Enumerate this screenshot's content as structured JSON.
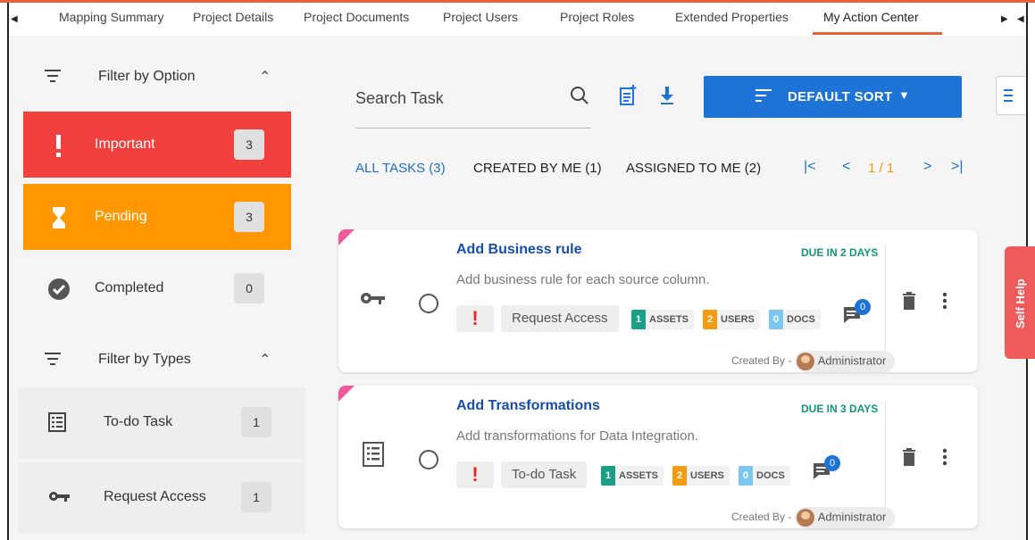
{
  "tabs": [
    {
      "label": "Mapping Summary"
    },
    {
      "label": "Project Details"
    },
    {
      "label": "Project Documents"
    },
    {
      "label": "Project Users"
    },
    {
      "label": "Project Roles"
    },
    {
      "label": "Extended Properties"
    },
    {
      "label": "My Action Center",
      "active": true
    }
  ],
  "sidebar": {
    "filter_by_option": {
      "label": "Filter by Option",
      "items": [
        {
          "label": "Important",
          "count": "3"
        },
        {
          "label": "Pending",
          "count": "3"
        },
        {
          "label": "Completed",
          "count": "0"
        }
      ]
    },
    "filter_by_types": {
      "label": "Filter by Types",
      "items": [
        {
          "label": "To-do Task",
          "count": "1"
        },
        {
          "label": "Request Access",
          "count": "1"
        }
      ]
    }
  },
  "main": {
    "search_placeholder": "Search Task",
    "sort_label": "DEFAULT SORT",
    "subtabs": {
      "all": "ALL TASKS (3)",
      "created": "CREATED BY ME (1)",
      "assigned": "ASSIGNED TO ME (2)"
    },
    "pager": {
      "page": "1 / 1"
    },
    "tasks": [
      {
        "title": "Add Business rule",
        "due": "DUE IN 2 DAYS",
        "description": "Add business rule for each source column.",
        "type": "Request Access",
        "assets": "1",
        "assets_label": "ASSETS",
        "users": "2",
        "users_label": "USERS",
        "docs": "0",
        "docs_label": "DOCS",
        "comments": "0",
        "created_by_label": "Created By -",
        "creator": "Administrator"
      },
      {
        "title": "Add Transformations",
        "due": "DUE IN 3 DAYS",
        "description": "Add transformations for Data Integration.",
        "type": "To-do Task",
        "assets": "1",
        "assets_label": "ASSETS",
        "users": "2",
        "users_label": "USERS",
        "docs": "0",
        "docs_label": "DOCS",
        "comments": "0",
        "created_by_label": "Created By -",
        "creator": "Administrator"
      }
    ]
  },
  "self_help_label": "Self Help",
  "colors": {
    "accent": "#e8613a",
    "important": "#f2403f",
    "pending": "#ff9800",
    "primary": "#1e74d6",
    "due": "#12977a"
  }
}
